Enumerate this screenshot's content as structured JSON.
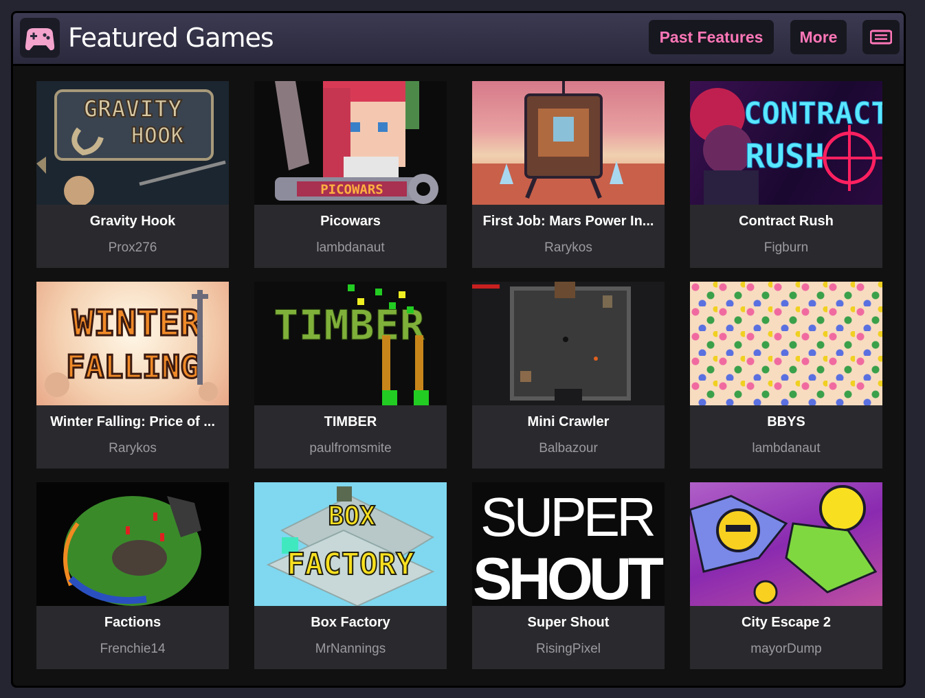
{
  "header": {
    "title": "Featured Games",
    "past_features_label": "Past Features",
    "more_label": "More",
    "icons": {
      "logo": "gamepad-icon",
      "menu": "list-menu-icon"
    },
    "colors": {
      "accent": "#ff77b8",
      "title": "#ffffff"
    }
  },
  "games": [
    {
      "title": "Gravity Hook",
      "author": "Prox276"
    },
    {
      "title": "Picowars",
      "author": "lambdanaut"
    },
    {
      "title": "First Job: Mars Power In...",
      "author": "Rarykos"
    },
    {
      "title": "Contract Rush",
      "author": "Figburn"
    },
    {
      "title": "Winter Falling: Price of ...",
      "author": "Rarykos"
    },
    {
      "title": "TIMBER",
      "author": "paulfromsmite"
    },
    {
      "title": "Mini Crawler",
      "author": "Balbazour"
    },
    {
      "title": "BBYS",
      "author": "lambdanaut"
    },
    {
      "title": "Factions",
      "author": "Frenchie14"
    },
    {
      "title": "Box Factory",
      "author": "MrNannings"
    },
    {
      "title": "Super Shout",
      "author": "RisingPixel"
    },
    {
      "title": "City Escape 2",
      "author": "mayorDump"
    }
  ],
  "thumbnail_text": {
    "gravity_hook": [
      "GRAVITY",
      "HOOK"
    ],
    "picowars": "PICOWARS",
    "contract_rush": [
      "CONTRACT",
      "RUSH"
    ],
    "winter_falling": [
      "WINTER",
      "FALLING"
    ],
    "timber": "TIMBER",
    "box_factory": [
      "BOX",
      "FACTORY"
    ],
    "super_shout": [
      "SUPER",
      "SHOUT"
    ]
  }
}
